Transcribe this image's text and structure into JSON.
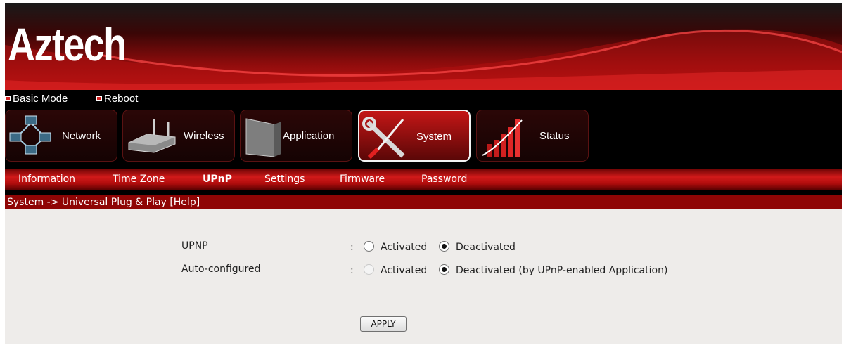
{
  "brand": {
    "logo_text": "Aztech"
  },
  "mode_links": [
    {
      "label": "Basic Mode"
    },
    {
      "label": "Reboot"
    }
  ],
  "main_tabs": [
    {
      "label": "Network",
      "icon": "network-icon",
      "active": false
    },
    {
      "label": "Wireless",
      "icon": "router-icon",
      "active": false
    },
    {
      "label": "Application",
      "icon": "device-icon",
      "active": false
    },
    {
      "label": "System",
      "icon": "tools-icon",
      "active": true
    },
    {
      "label": "Status",
      "icon": "chart-icon",
      "active": false
    }
  ],
  "sub_tabs": [
    {
      "label": "Information",
      "active": false
    },
    {
      "label": "Time Zone",
      "active": false
    },
    {
      "label": "UPnP",
      "active": true
    },
    {
      "label": "Settings",
      "active": false
    },
    {
      "label": "Firmware",
      "active": false
    },
    {
      "label": "Password",
      "active": false
    }
  ],
  "breadcrumb": "System -> Universal Plug & Play [Help]",
  "form": {
    "upnp": {
      "label": "UPNP",
      "colon": ":",
      "activated_label": "Activated",
      "deactivated_label": "Deactivated",
      "selected": "deactivated"
    },
    "auto_configured": {
      "label": "Auto-configured",
      "colon": ":",
      "activated_label": "Activated",
      "deactivated_label": "Deactivated (by UPnP-enabled Application)",
      "selected": "deactivated",
      "activated_disabled": true
    },
    "apply_label": "APPLY"
  },
  "colors": {
    "brand_red": "#c41414",
    "dark_red": "#8f0505",
    "content_bg": "#eeecea"
  }
}
